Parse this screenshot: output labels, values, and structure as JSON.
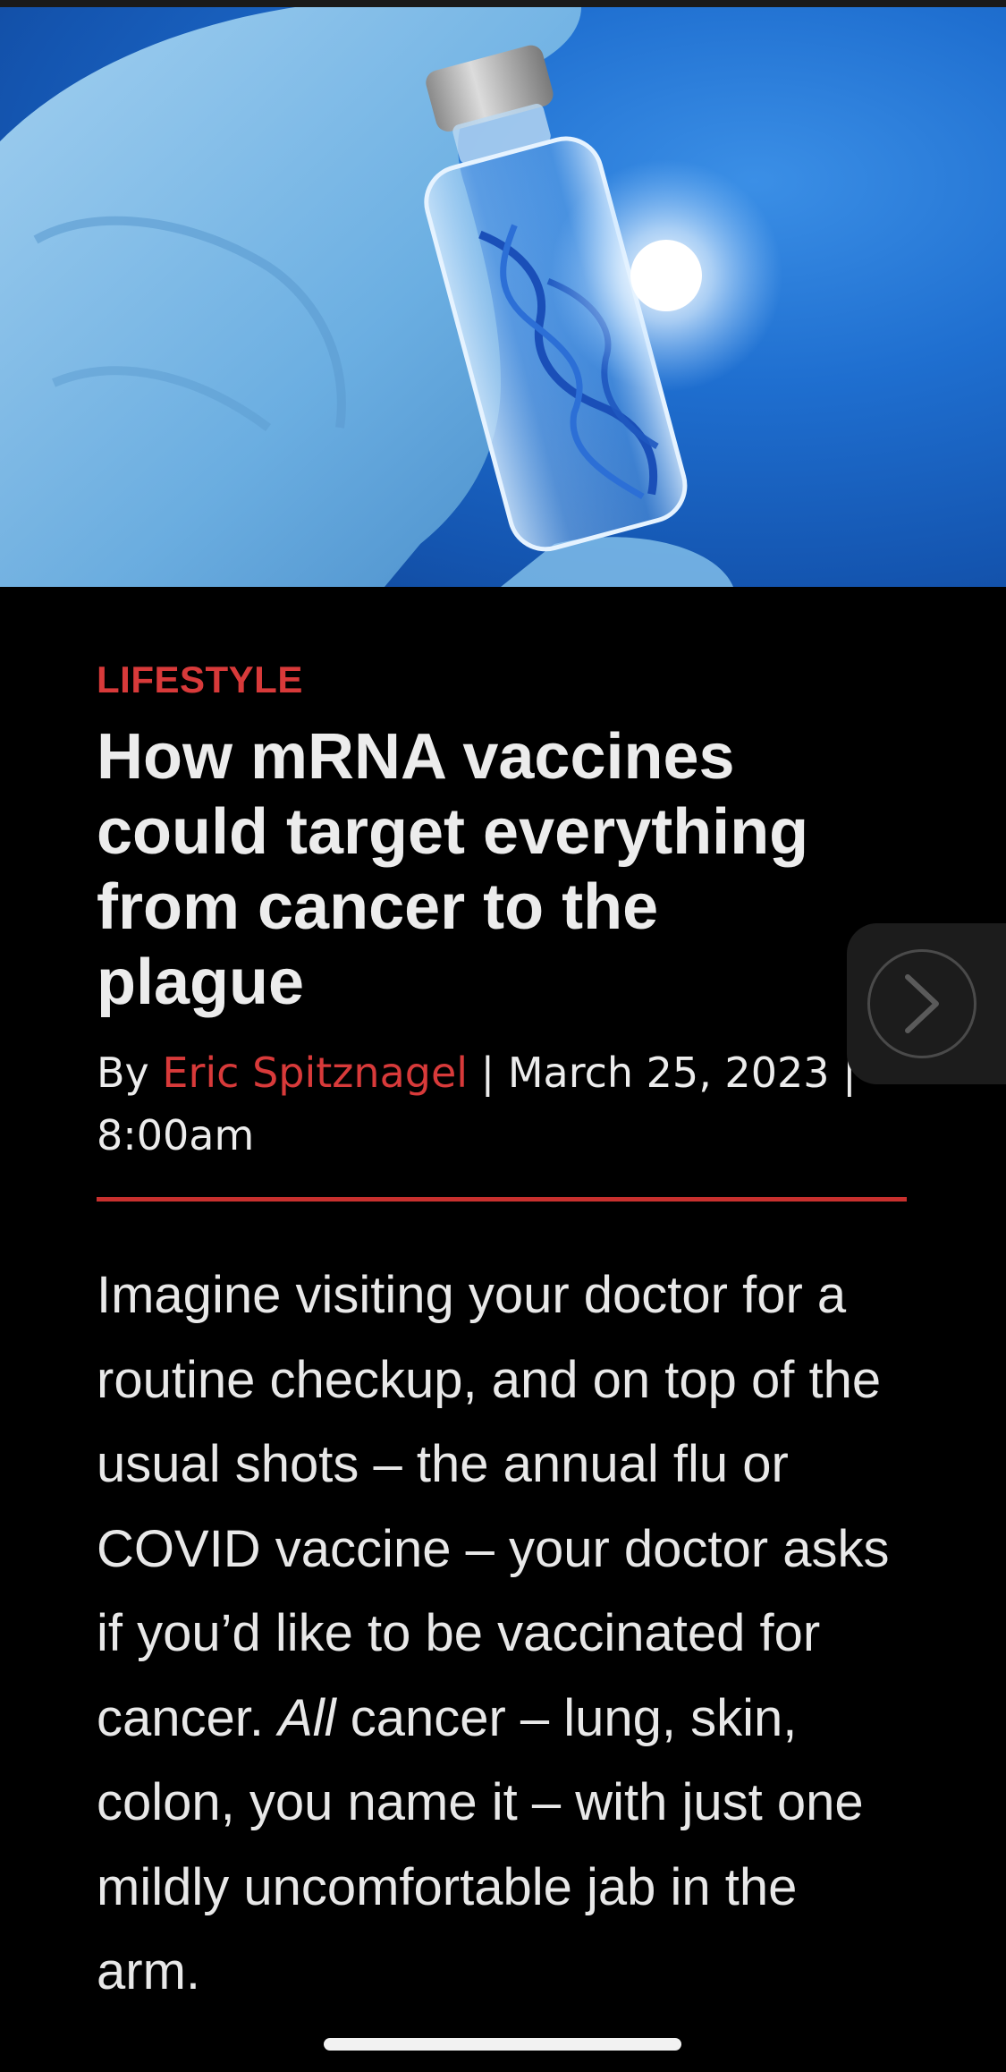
{
  "article": {
    "category": "LIFESTYLE",
    "headline": "How mRNA vaccines\ncould  target everything\nfrom cancer to the\nplague",
    "byline": {
      "prefix": "By ",
      "author": "Eric Spitznagel",
      "separator1": " | ",
      "date": "March 25, 2023",
      "separator2": " |",
      "time": "8:00am"
    },
    "body": {
      "text1": "Imagine visiting your doctor for a routine checkup, and on top of the usual shots – the annu­al flu or COVID vaccine – your doctor asks if you’d like to be vaccinated for cancer. ",
      "emphasis": "All",
      "text2": " can­cer – lung, skin, colon, you name it – with just one mildly uncomfortable jab in the arm."
    }
  },
  "hero_image": {
    "icon": "vaccine-vial-dna-image"
  },
  "next_button": {
    "icon": "chevron-right-icon"
  },
  "colors": {
    "accent": "#d83a3a",
    "background": "#000000",
    "text": "#ececec"
  }
}
